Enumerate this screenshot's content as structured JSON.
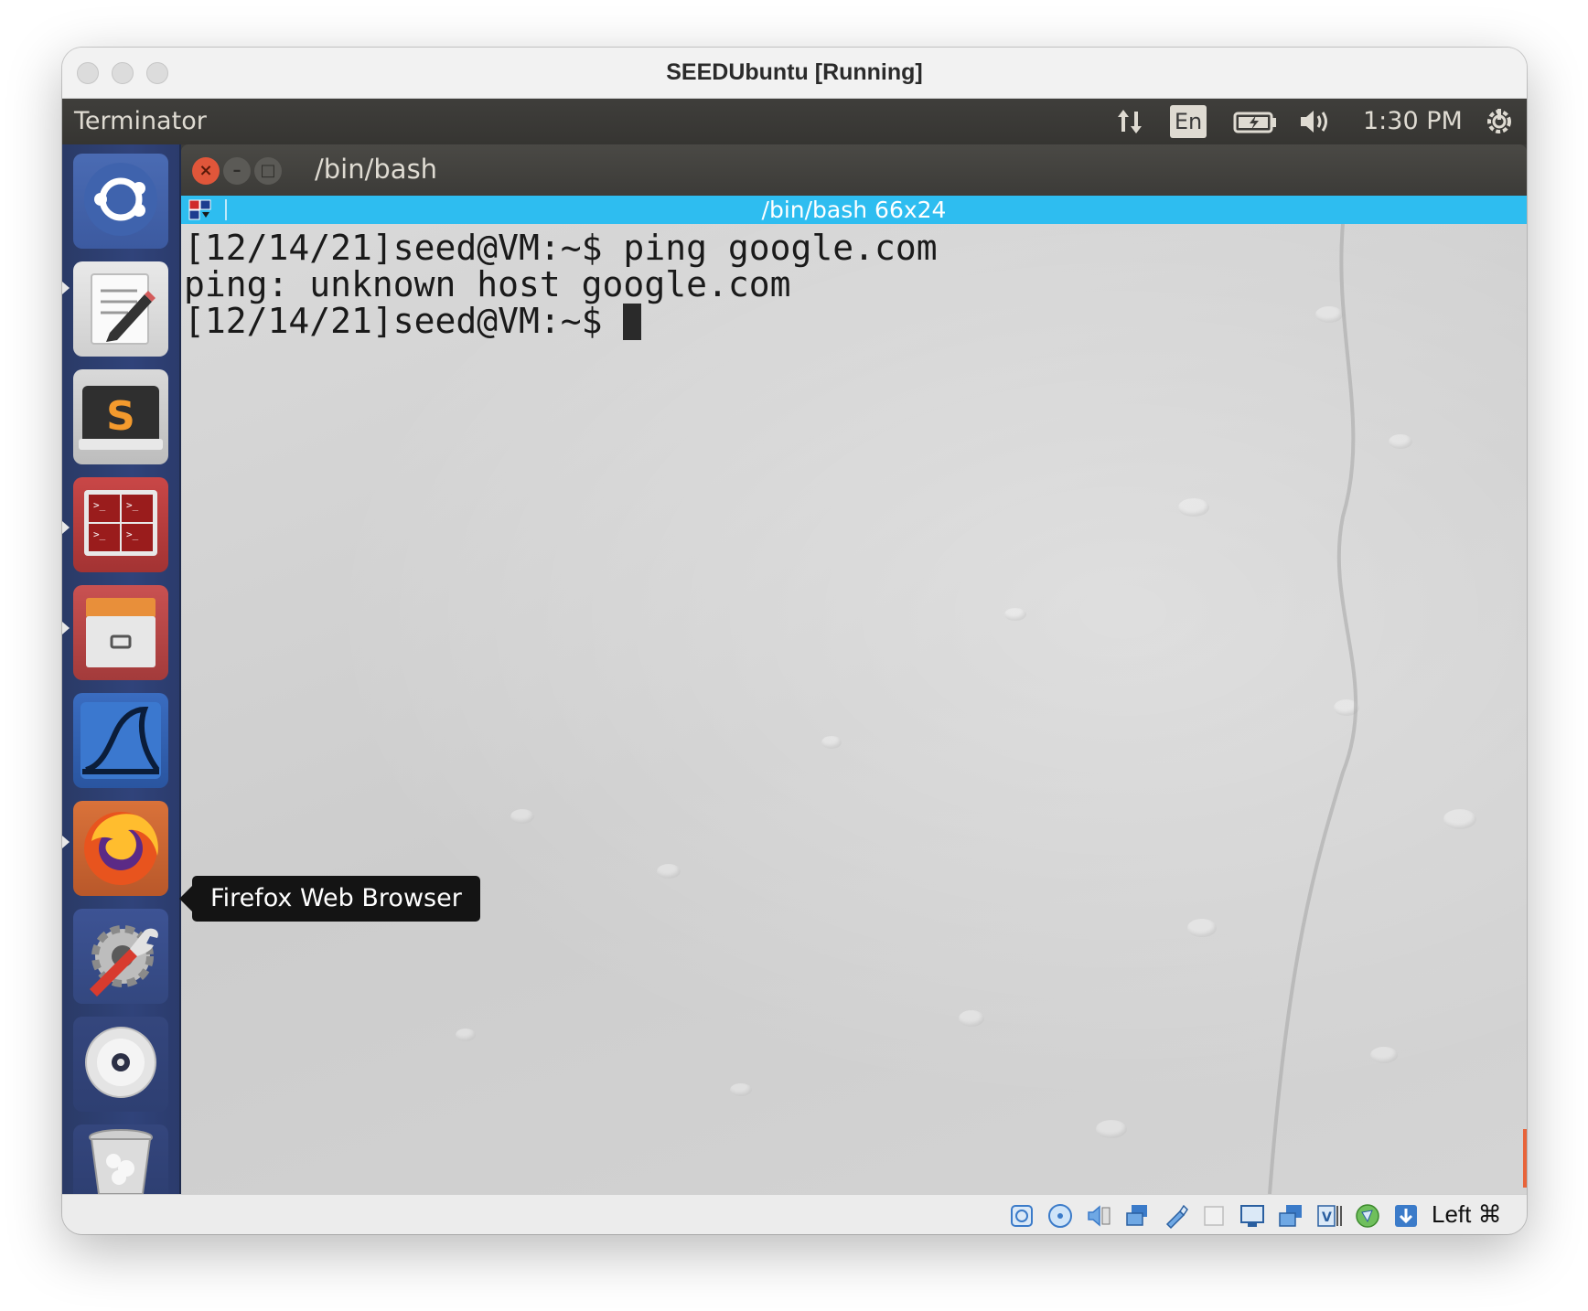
{
  "mac_window": {
    "title": "SEEDUbuntu [Running]"
  },
  "top_panel": {
    "app_name": "Terminator",
    "icons": [
      "network-arrows-icon",
      "keyboard-layout-icon",
      "battery-icon",
      "volume-icon",
      "power-gear-icon"
    ],
    "language": "En",
    "clock": "1:30 PM"
  },
  "launcher": {
    "items": [
      {
        "name": "ubuntu-dash",
        "icon": "ubuntu-logo-icon"
      },
      {
        "name": "text-editor",
        "icon": "text-editor-icon"
      },
      {
        "name": "sublime-text",
        "icon": "sublime-text-icon"
      },
      {
        "name": "terminator",
        "icon": "terminator-icon"
      },
      {
        "name": "file-archive",
        "icon": "file-cabinet-icon"
      },
      {
        "name": "wireshark",
        "icon": "wireshark-fin-icon"
      },
      {
        "name": "firefox",
        "icon": "firefox-icon"
      },
      {
        "name": "system-settings",
        "icon": "settings-wrench-icon"
      },
      {
        "name": "dvd-drive",
        "icon": "disc-icon"
      },
      {
        "name": "trash",
        "icon": "trash-icon"
      }
    ],
    "tooltip": "Firefox Web Browser"
  },
  "terminal": {
    "title": "/bin/bash",
    "tab_label": "/bin/bash 66x24",
    "lines": [
      "[12/14/21]seed@VM:~$ ping google.com",
      "ping: unknown host google.com",
      "[12/14/21]seed@VM:~$ "
    ]
  },
  "status_bar": {
    "icons": [
      "hard-disk-icon",
      "optical-disc-icon",
      "audio-icon",
      "network-icon",
      "usb-icon",
      "shared-folder-icon",
      "display-icon",
      "screen-capture-icon",
      "video-capture-icon",
      "cpu-icon",
      "mouse-integration-icon",
      "host-key-arrow-icon"
    ],
    "host_key": "Left ⌘"
  },
  "colors": {
    "tab_bar": "#2ebdf0",
    "launcher": "#2e3f72",
    "panel": "#3c3b38"
  }
}
